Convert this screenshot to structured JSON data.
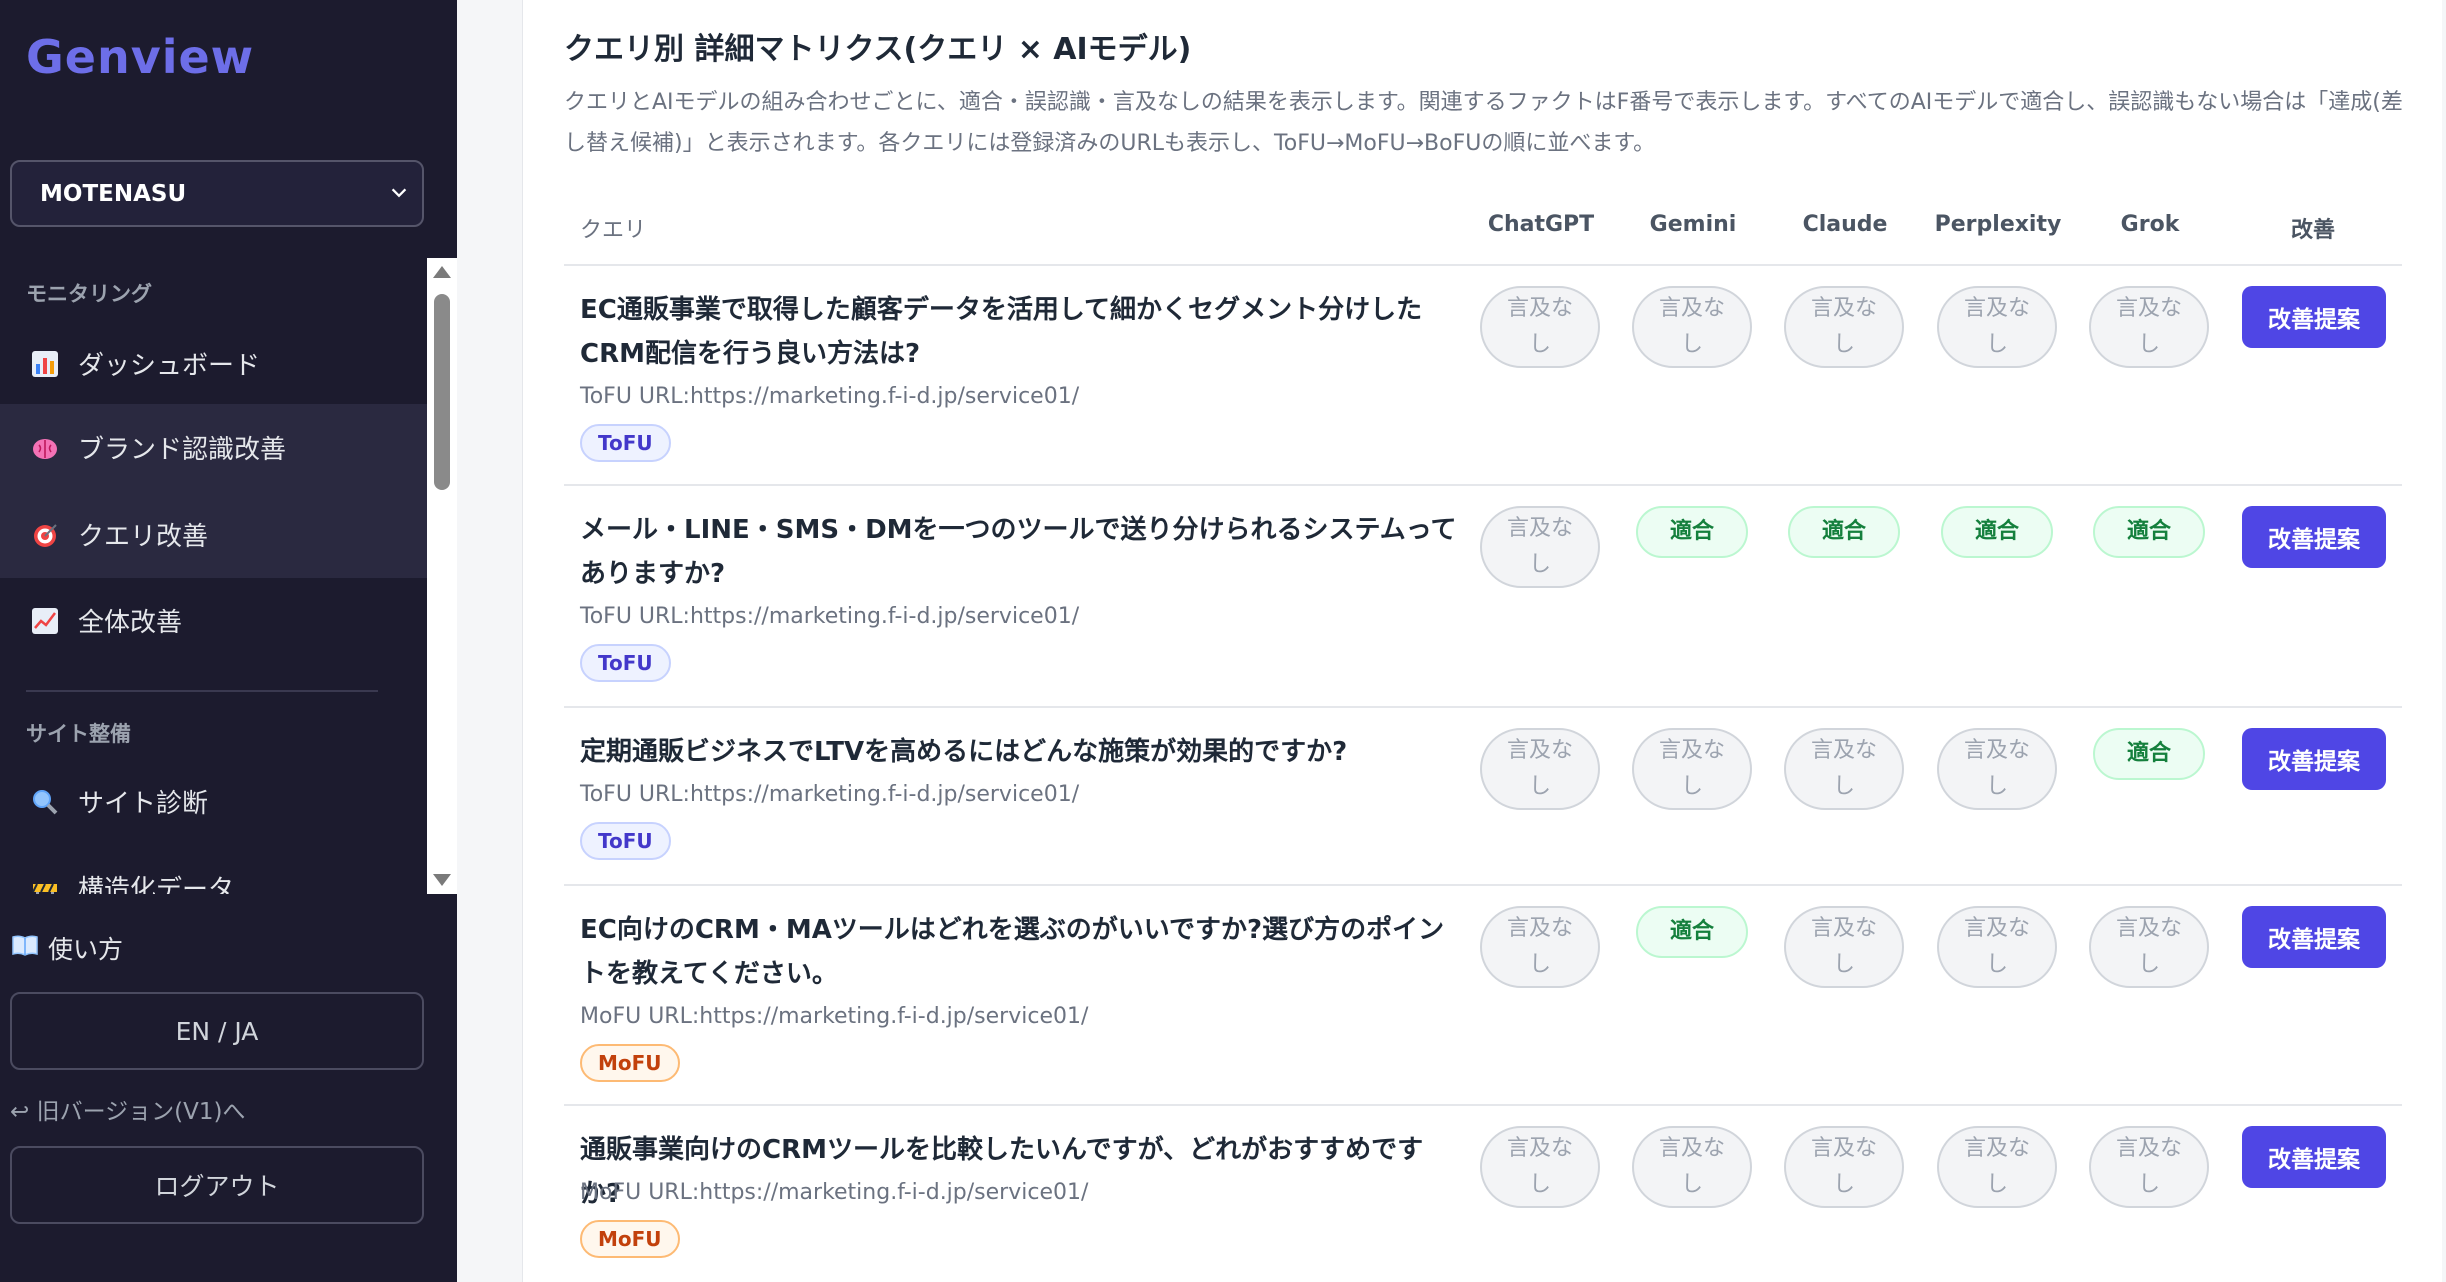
{
  "app": {
    "logo": "Genview"
  },
  "project_select": {
    "value": "MOTENASU"
  },
  "sidebar": {
    "monitoring_label": "モニタリング",
    "site_label": "サイト整備",
    "items": [
      {
        "label": "ダッシュボード",
        "icon": "bar-chart-icon"
      },
      {
        "label": "ブランド認識改善",
        "icon": "brain-icon"
      },
      {
        "label": "クエリ改善",
        "icon": "target-icon"
      },
      {
        "label": "全体改善",
        "icon": "line-chart-icon"
      },
      {
        "label": "サイト診断",
        "icon": "magnifier-icon"
      },
      {
        "label": "構造化データ",
        "icon": "construction-icon"
      }
    ],
    "usage": "使い方",
    "lang": "EN / JA",
    "old_version": "↩ 旧バージョン(V1)へ",
    "logout": "ログアウト"
  },
  "main": {
    "title": "クエリ別 詳細マトリクス(クエリ × AIモデル)",
    "description": "クエリとAIモデルの組み合わせごとに、適合・誤認識・言及なしの結果を表示します。関連するファクトはF番号で表示します。すべてのAIモデルで適合し、誤認識もない場合は「達成(差し替え候補)」と表示されます。各クエリには登録済みのURLも表示し、ToFU→MoFU→BoFUの順に並べます。",
    "columns": [
      "クエリ",
      "ChatGPT",
      "Gemini",
      "Claude",
      "Perplexity",
      "Grok",
      "改善"
    ],
    "improve_label": "改善提案",
    "rows": [
      {
        "query": "EC通販事業で取得した顧客データを活用して細かくセグメント分けしたCRM配信を行う良い方法は?",
        "meta": "ToFU URL:https://marketing.f-i-d.jp/service01/",
        "stage": "ToFU",
        "results": [
          "言及なし",
          "言及なし",
          "言及なし",
          "言及なし",
          "言及なし"
        ]
      },
      {
        "query": "メール・LINE・SMS・DMを一つのツールで送り分けられるシステムってありますか?",
        "meta": "ToFU URL:https://marketing.f-i-d.jp/service01/",
        "stage": "ToFU",
        "results": [
          "言及なし",
          "適合",
          "適合",
          "適合",
          "適合"
        ]
      },
      {
        "query": "定期通販ビジネスでLTVを高めるにはどんな施策が効果的ですか?",
        "meta": "ToFU URL:https://marketing.f-i-d.jp/service01/",
        "stage": "ToFU",
        "results": [
          "言及なし",
          "言及なし",
          "言及なし",
          "言及なし",
          "適合"
        ]
      },
      {
        "query": "EC向けのCRM・MAツールはどれを選ぶのがいいですか?選び方のポイントを教えてください。",
        "meta": "MoFU URL:https://marketing.f-i-d.jp/service01/",
        "stage": "MoFU",
        "results": [
          "言及なし",
          "適合",
          "言及なし",
          "言及なし",
          "言及なし"
        ]
      },
      {
        "query": "通販事業向けのCRMツールを比較したいんですが、どれがおすすめですか?",
        "meta": "MoFU URL:https://marketing.f-i-d.jp/service01/",
        "stage": "MoFU",
        "results": [
          "言及なし",
          "言及なし",
          "言及なし",
          "言及なし",
          "言及なし"
        ]
      }
    ]
  }
}
